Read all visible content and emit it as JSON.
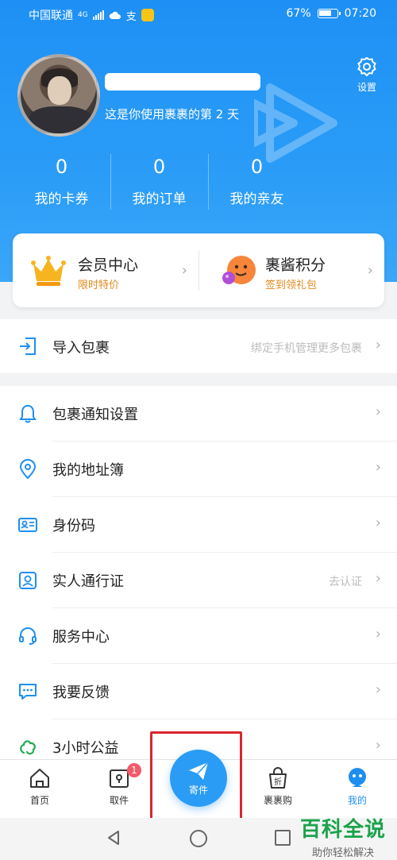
{
  "status_bar": {
    "carrier": "中国联通",
    "network": "4G",
    "battery_percent": "67%",
    "time": "07:20"
  },
  "profile": {
    "days_text": "这是你使用裹裹的第 2 天"
  },
  "settings": {
    "label": "设置"
  },
  "stats": [
    {
      "value": "0",
      "label": "我的卡券"
    },
    {
      "value": "0",
      "label": "我的订单"
    },
    {
      "value": "0",
      "label": "我的亲友"
    }
  ],
  "member_card": [
    {
      "title": "会员中心",
      "subtitle": "限时特价",
      "icon": "crown-icon"
    },
    {
      "title": "裹酱积分",
      "subtitle": "签到领礼包",
      "icon": "mascot-icon"
    }
  ],
  "import_row": {
    "label": "导入包裹",
    "hint": "绑定手机管理更多包裹",
    "icon": "import-icon"
  },
  "menu": [
    {
      "label": "包裹通知设置",
      "icon": "bell-icon",
      "hint": ""
    },
    {
      "label": "我的地址簿",
      "icon": "location-icon",
      "hint": ""
    },
    {
      "label": "身份码",
      "icon": "id-card-icon",
      "hint": ""
    },
    {
      "label": "实人通行证",
      "icon": "person-badge-icon",
      "hint": "去认证"
    },
    {
      "label": "服务中心",
      "icon": "headset-icon",
      "hint": ""
    },
    {
      "label": "我要反馈",
      "icon": "feedback-icon",
      "hint": ""
    },
    {
      "label": "3小时公益",
      "icon": "charity-icon",
      "hint": ""
    }
  ],
  "tabbar": {
    "home": "首页",
    "pickup": "取件",
    "pickup_badge": "1",
    "send": "寄件",
    "shop": "裹裹购",
    "mine": "我的"
  },
  "watermark": {
    "title": "百科全说",
    "subtitle": "助你轻松解决"
  },
  "colors": {
    "primary": "#1e90f5",
    "accent_orange": "#e38a1b",
    "badge": "#f35a6a",
    "highlight": "#d9262b"
  }
}
